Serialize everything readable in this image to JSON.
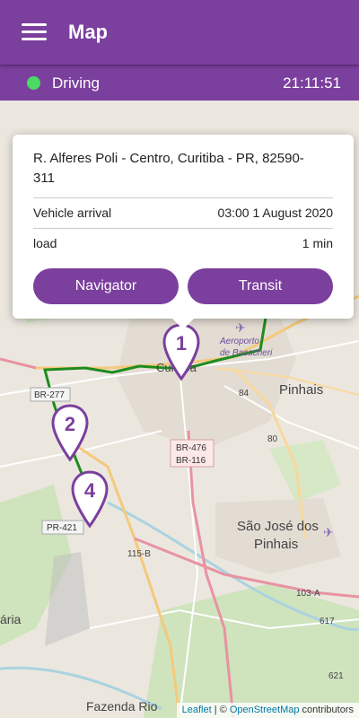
{
  "appbar": {
    "title": "Map"
  },
  "status": {
    "label": "Driving",
    "time": "21:11:51",
    "dot_color": "#4cd964"
  },
  "popup": {
    "address": "R. Alferes Poli - Centro, Curitiba - PR, 82590-311",
    "rows": [
      {
        "label": "Vehicle arrival",
        "value": "03:00 1 August 2020"
      },
      {
        "label": "load",
        "value": "1 min"
      }
    ],
    "buttons": {
      "navigator": "Navigator",
      "transit": "Transit"
    }
  },
  "markers": [
    "1",
    "2",
    "4"
  ],
  "map_labels": {
    "city": "Curitiba",
    "airport": "Aeroporto de Bacacheri",
    "pinhais": "Pinhais",
    "sao_jose_1": "São José dos",
    "sao_jose_2": "Pinhais",
    "fazenda": "Fazenda Rio",
    "araucaria": "ária",
    "br277": "BR-277",
    "br476": "BR-476",
    "br116": "BR-116",
    "pr421": "PR-421",
    "r84": "84",
    "r80": "80",
    "r115b": "115-B",
    "r103a": "103-A",
    "r617": "617",
    "r621": "621"
  },
  "attribution": {
    "leaflet": "Leaflet",
    "sep": " | © ",
    "osm": "OpenStreetMap",
    "contributors": " contributors"
  },
  "colors": {
    "brand": "#7b3f9e",
    "route": "#1e8c1e"
  }
}
